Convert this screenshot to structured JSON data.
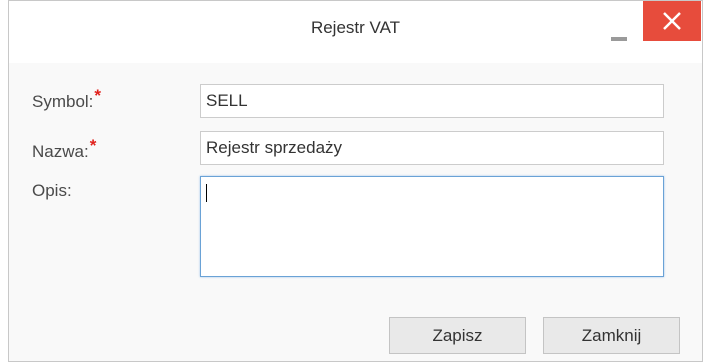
{
  "dialog": {
    "title": "Rejestr VAT",
    "minimize_icon": "minimize-icon",
    "close_icon": "close-icon",
    "close_color": "#e74c3c"
  },
  "form": {
    "symbol": {
      "label": "Symbol:",
      "required_marker": "*",
      "value": "SELL"
    },
    "name": {
      "label": "Nazwa:",
      "required_marker": "*",
      "value": "Rejestr sprzedaży"
    },
    "description": {
      "label": "Opis:",
      "value": ""
    }
  },
  "buttons": {
    "save": "Zapisz",
    "close": "Zamknij"
  }
}
